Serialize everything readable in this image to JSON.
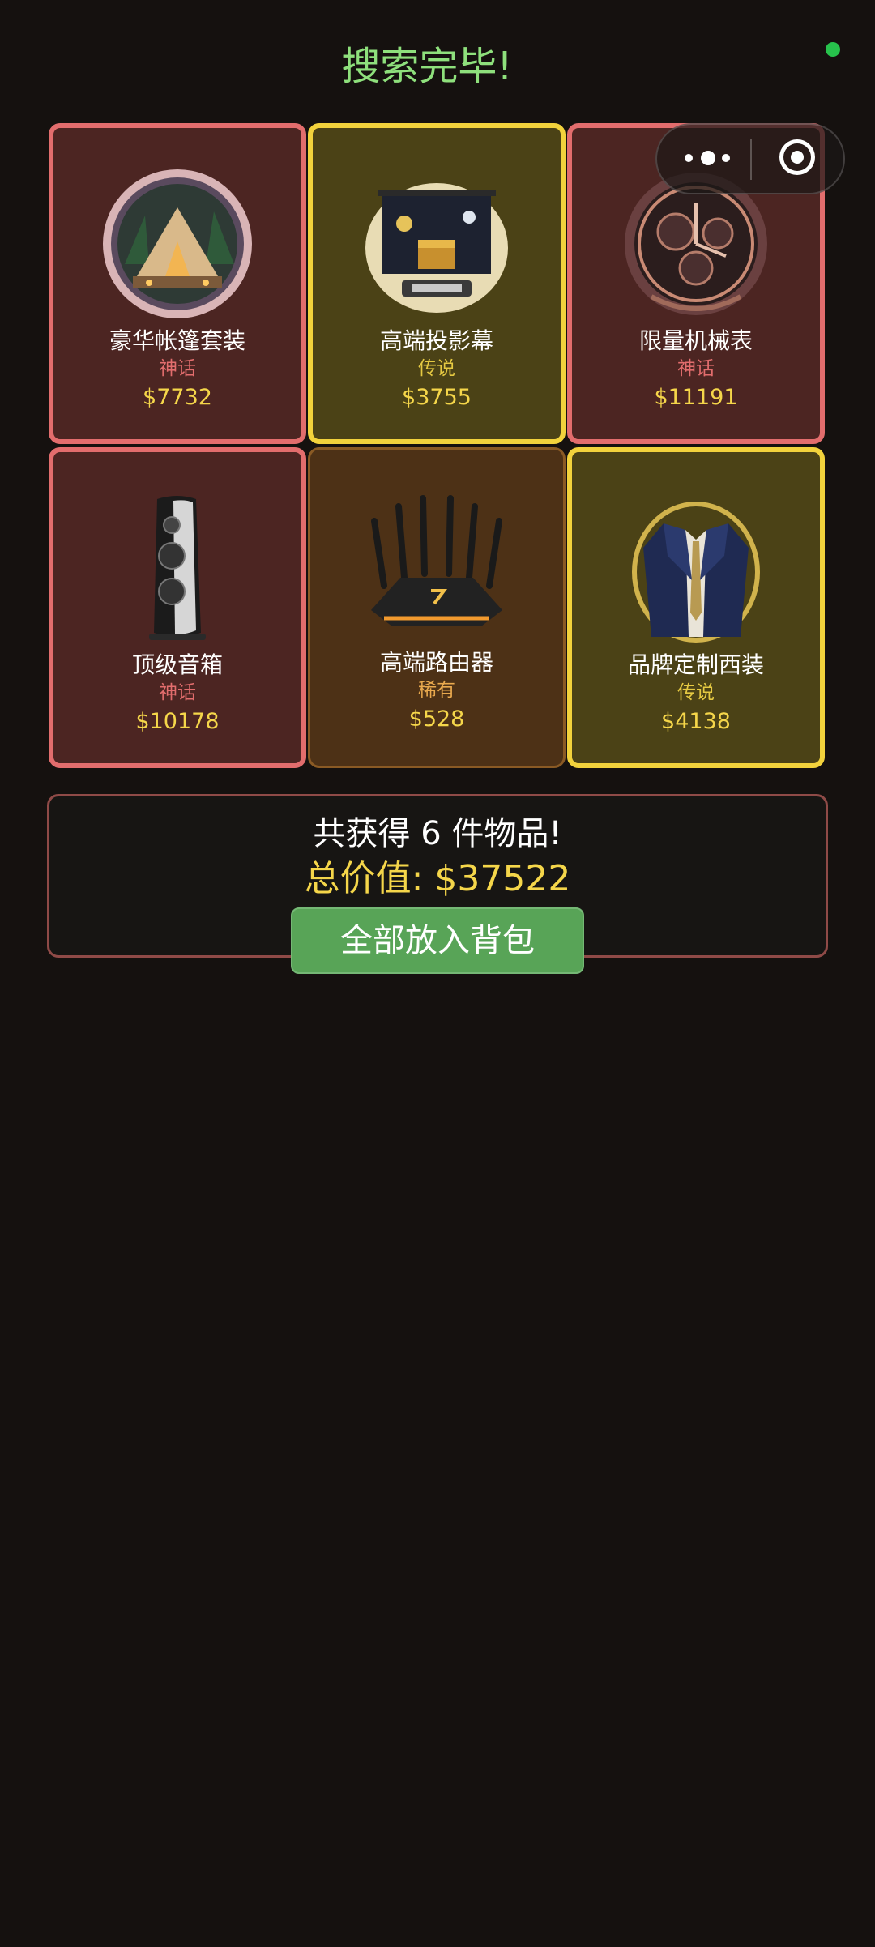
{
  "header": {
    "title": "搜索完毕!"
  },
  "capsule": {
    "more_icon": "more-dots-icon",
    "close_icon": "target-circle-icon"
  },
  "items": [
    {
      "name": "豪华帐篷套装",
      "rarity": "神话",
      "price": "$7732",
      "tier": "mythic",
      "icon": "tent-icon"
    },
    {
      "name": "高端投影幕",
      "rarity": "传说",
      "price": "$3755",
      "tier": "legend",
      "icon": "projector-screen-icon"
    },
    {
      "name": "限量机械表",
      "rarity": "神话",
      "price": "$11191",
      "tier": "mythic",
      "icon": "watch-icon"
    },
    {
      "name": "顶级音箱",
      "rarity": "神话",
      "price": "$10178",
      "tier": "mythic",
      "icon": "speaker-icon"
    },
    {
      "name": "高端路由器",
      "rarity": "稀有",
      "price": "$528",
      "tier": "rare",
      "icon": "router-icon"
    },
    {
      "name": "品牌定制西装",
      "rarity": "传说",
      "price": "$4138",
      "tier": "legend",
      "icon": "suit-icon"
    }
  ],
  "summary": {
    "count_text": "共获得 6 件物品!",
    "total_text": "总价值: $37522",
    "button_label": "全部放入背包"
  },
  "colors": {
    "background": "#15110f",
    "title": "#8ee07c",
    "mythic_border": "#e26d6d",
    "legend_border": "#f2d23c",
    "rare_border": "#8a5a24",
    "price": "#f5d64a",
    "button": "#58a457"
  }
}
